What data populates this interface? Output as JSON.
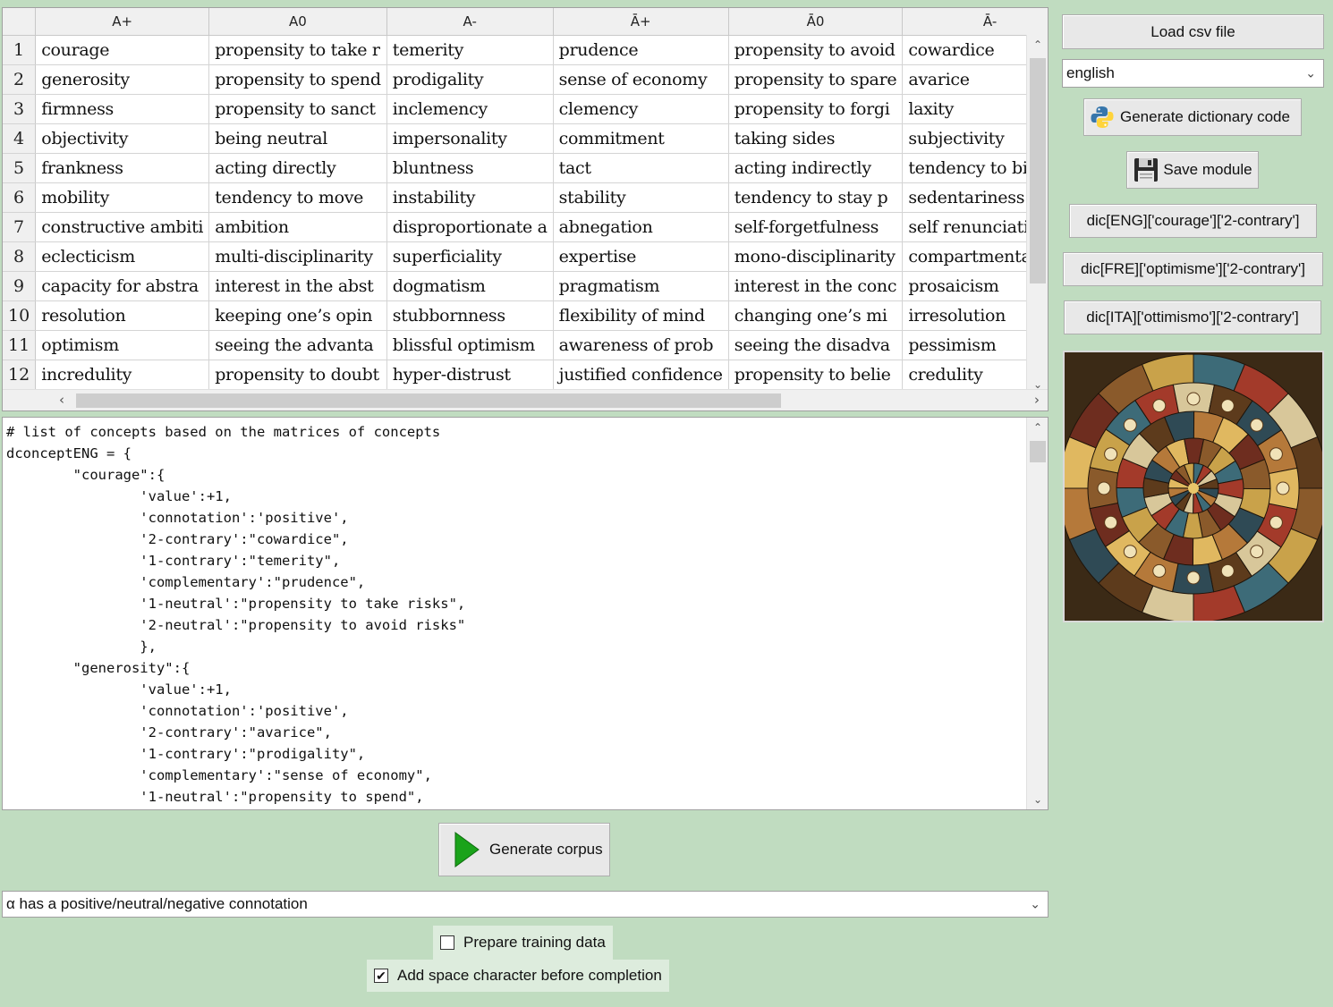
{
  "table": {
    "columns": [
      "A+",
      "A0",
      "A-",
      "Ā+",
      "Ā0",
      "Ā-"
    ],
    "rows": [
      {
        "n": "1",
        "cells": [
          "courage",
          "propensity to take r",
          "temerity",
          "prudence",
          "propensity to avoid",
          "cowardice"
        ]
      },
      {
        "n": "2",
        "cells": [
          "generosity",
          "propensity to spend",
          "prodigality",
          "sense of economy",
          "propensity to spare",
          "avarice"
        ]
      },
      {
        "n": "3",
        "cells": [
          "firmness",
          "propensity to sanct",
          "inclemency",
          "clemency",
          "propensity to forgi",
          "laxity"
        ]
      },
      {
        "n": "4",
        "cells": [
          "objectivity",
          "being neutral",
          "impersonality",
          "commitment",
          "taking sides",
          "subjectivity"
        ]
      },
      {
        "n": "5",
        "cells": [
          "frankness",
          "acting directly",
          "bluntness",
          "tact",
          "acting indirectly",
          "tendency to bias"
        ]
      },
      {
        "n": "6",
        "cells": [
          "mobility",
          "tendency to move",
          "instability",
          "stability",
          "tendency to stay p",
          "sedentariness"
        ]
      },
      {
        "n": "7",
        "cells": [
          "constructive ambiti",
          "ambition",
          "disproportionate a",
          "abnegation",
          "self-forgetfulness",
          "self renunciation"
        ]
      },
      {
        "n": "8",
        "cells": [
          "eclecticism",
          "multi-disciplinarity",
          "superficiality",
          "expertise",
          "mono-disciplinarity",
          "compartmentalizati"
        ]
      },
      {
        "n": "9",
        "cells": [
          "capacity for abstra",
          "interest in the abst",
          "dogmatism",
          "pragmatism",
          "interest in the conc",
          "prosaicism"
        ]
      },
      {
        "n": "10",
        "cells": [
          "resolution",
          "keeping one’s opin",
          "stubbornness",
          "flexibility of mind",
          "changing one’s mi",
          "irresolution"
        ]
      },
      {
        "n": "11",
        "cells": [
          "optimism",
          "seeing the advanta",
          "blissful optimism",
          "awareness of prob",
          "seeing the disadva",
          "pessimism"
        ]
      },
      {
        "n": "12",
        "cells": [
          "incredulity",
          "propensity to doubt",
          "hyper-distrust",
          "justified confidence",
          "propensity to belie",
          "credulity"
        ]
      }
    ]
  },
  "editor": {
    "code": "# list of concepts based on the matrices of concepts\ndconceptENG = {\n        \"courage\":{\n                'value':+1,\n                'connotation':'positive',\n                '2-contrary':\"cowardice\",\n                '1-contrary':\"temerity\",\n                'complementary':\"prudence\",\n                '1-neutral':\"propensity to take risks\",\n                '2-neutral':\"propensity to avoid risks\"\n                },\n        \"generosity\":{\n                'value':+1,\n                'connotation':'positive',\n                '2-contrary':\"avarice\",\n                '1-contrary':\"prodigality\",\n                'complementary':\"sense of economy\",\n                '1-neutral':\"propensity to spend\","
  },
  "right_panel": {
    "load_csv": "Load csv file",
    "language_select": "english",
    "generate_dict": "Generate dictionary code",
    "save_module": "Save module",
    "example_1": "dic[ENG]['courage']['2-contrary']",
    "example_2": "dic[FRE]['optimisme']['2-contrary']",
    "example_3": "dic[ITA]['ottimismo']['2-contrary']"
  },
  "bottom": {
    "generate_corpus": "Generate corpus",
    "template_select": "α has a positive/neutral/negative connotation",
    "prepare_training": "Prepare training data",
    "prepare_training_checked": false,
    "add_space": "Add space character before completion",
    "add_space_checked": true
  },
  "colors": {
    "background": "#c0dcc0",
    "play_green": "#1aa31a"
  }
}
